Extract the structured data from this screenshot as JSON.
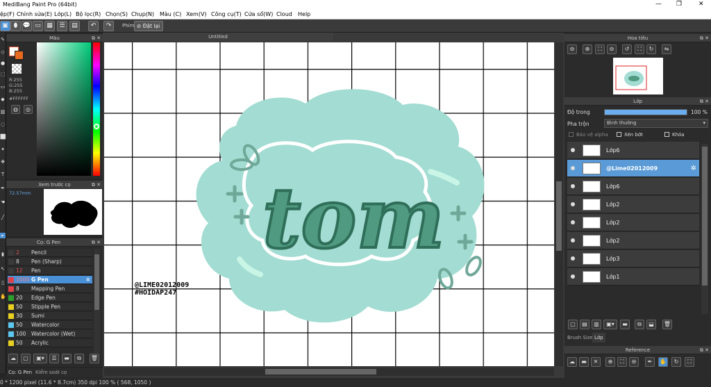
{
  "window": {
    "title": "MediBang Paint Pro (64bit)"
  },
  "menu": [
    "ệp(F)",
    "Chỉnh sửa(E)",
    "Lớp(L)",
    "Bộ lọc(R)",
    "Chọn(S)",
    "Chụp(N)",
    "Màu (C)",
    "Xem(V)",
    "Công cụ(T)",
    "Cửa sổ(W)",
    "Cloud",
    "Help"
  ],
  "toolbar": {
    "phim_label": "Phím",
    "reset_label": "Đặt lại"
  },
  "color_panel": {
    "title": "Màu",
    "r": "R:255",
    "g": "G:255",
    "b": "B:255",
    "hex": "#FFFFFF",
    "hue_color": "#00cc7a"
  },
  "preview_panel": {
    "title": "Xem trước cọ",
    "size": "72.57mm"
  },
  "brush_panel": {
    "title": "Cọ: G Pen",
    "brushes": [
      {
        "size": "2",
        "name": "Pencil",
        "color": "#3a3a3a"
      },
      {
        "size": "8",
        "name": "Pen (Sharp)",
        "color": "#3a3a3a"
      },
      {
        "size": "12",
        "name": "Pen",
        "color": "#3a3a3a"
      },
      {
        "size": "1000",
        "name": "G Pen",
        "color": "#e0404a",
        "selected": true
      },
      {
        "size": "8",
        "name": "Mapping Pen",
        "color": "#e0404a"
      },
      {
        "size": "20",
        "name": "Edge Pen",
        "color": "#2aa02a"
      },
      {
        "size": "50",
        "name": "Stipple Pen",
        "color": "#e8d020"
      },
      {
        "size": "30",
        "name": "Sumi",
        "color": "#e8d020"
      },
      {
        "size": "50",
        "name": "Watercolor",
        "color": "#5cc8f0"
      },
      {
        "size": "100",
        "name": "Watercolor (Wet)",
        "color": "#5cc8f0"
      },
      {
        "size": "50",
        "name": "Acrylic",
        "color": "#e8d020"
      }
    ],
    "tabs": [
      "Cọ: G Pen",
      "Kiểm soát cọ"
    ]
  },
  "document": {
    "tab": "Untitled"
  },
  "artwork": {
    "word": "tom",
    "signature_line1": "@LIME02012009",
    "signature_line2": "#HOIDAP247"
  },
  "navigator": {
    "title": "Hoa tiêu"
  },
  "layers_panel": {
    "title": "Lớp",
    "opacity_label": "Độ trong",
    "opacity_value": "100 %",
    "opacity": 1.0,
    "blend_label": "Pha trộn",
    "blend_value": "Bình thường",
    "protect_alpha": "Bảo vệ alpha",
    "clipping": "Xén bớt",
    "lock": "Khóa",
    "layers": [
      {
        "name": "Lớp6"
      },
      {
        "name": "@Lime02012009",
        "selected": true
      },
      {
        "name": "Lớp6"
      },
      {
        "name": "Lớp2"
      },
      {
        "name": "Lớp2"
      },
      {
        "name": "Lớp2"
      },
      {
        "name": "Lớp3"
      },
      {
        "name": "Lớp1"
      }
    ],
    "tabs": [
      "Brush Size",
      "Lớp"
    ]
  },
  "reference_panel": {
    "title": "Reference"
  },
  "status": {
    "text": "0 * 1200 pixel   (11.6 * 8.7cm)   350 dpi   100 %   ( 568, 1050 )"
  }
}
